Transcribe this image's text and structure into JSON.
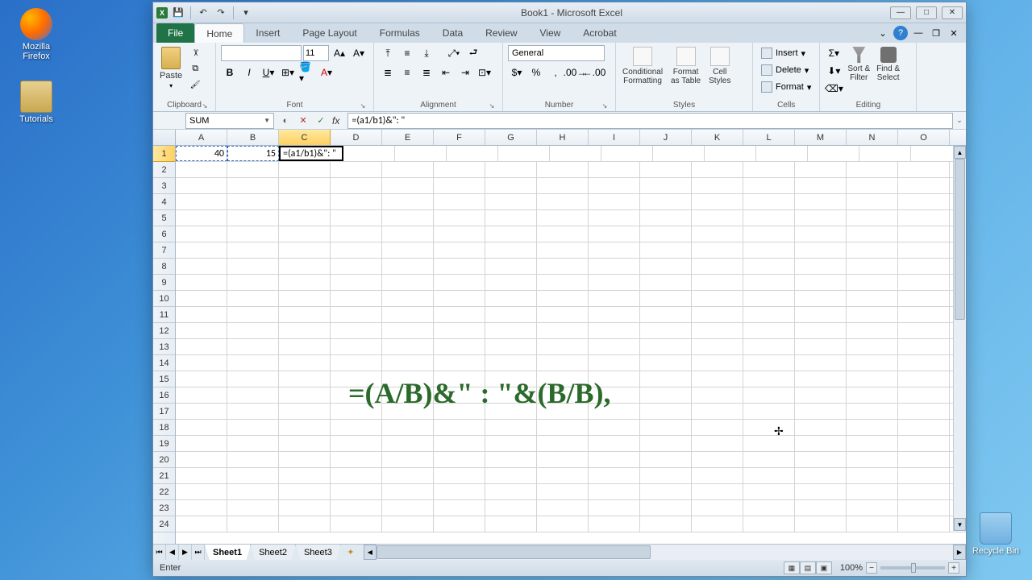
{
  "desktop": {
    "firefox_label": "Mozilla Firefox",
    "tutorials_label": "Tutorials",
    "recycle_label": "Recycle Bin"
  },
  "window": {
    "title": "Book1 - Microsoft Excel"
  },
  "ribbon": {
    "file": "File",
    "tabs": [
      "Home",
      "Insert",
      "Page Layout",
      "Formulas",
      "Data",
      "Review",
      "View",
      "Acrobat"
    ],
    "active_tab": "Home",
    "groups": {
      "clipboard": {
        "label": "Clipboard",
        "paste": "Paste"
      },
      "font": {
        "label": "Font",
        "size": "11"
      },
      "alignment": {
        "label": "Alignment"
      },
      "number": {
        "label": "Number",
        "format": "General"
      },
      "styles": {
        "label": "Styles",
        "conditional": "Conditional\nFormatting",
        "table": "Format\nas Table",
        "cell": "Cell\nStyles"
      },
      "cells": {
        "label": "Cells",
        "insert": "Insert",
        "delete": "Delete",
        "format": "Format"
      },
      "editing": {
        "label": "Editing",
        "sort": "Sort &\nFilter",
        "find": "Find &\nSelect"
      }
    }
  },
  "formula_bar": {
    "name_box": "SUM",
    "formula": "=(a1/b1)&\": \""
  },
  "grid": {
    "columns": [
      "A",
      "B",
      "C",
      "D",
      "E",
      "F",
      "G",
      "H",
      "I",
      "J",
      "K",
      "L",
      "M",
      "N",
      "O"
    ],
    "active_col": "C",
    "active_row": "1",
    "row_count": 24,
    "cells": {
      "A1": "40",
      "B1": "15",
      "C1": "=(a1/b1)&\": \""
    }
  },
  "overlay_text": "=(A/B)&\" : \"&(B/B),",
  "sheets": {
    "tabs": [
      "Sheet1",
      "Sheet2",
      "Sheet3"
    ],
    "active": "Sheet1"
  },
  "status": {
    "mode": "Enter",
    "zoom": "100%"
  }
}
